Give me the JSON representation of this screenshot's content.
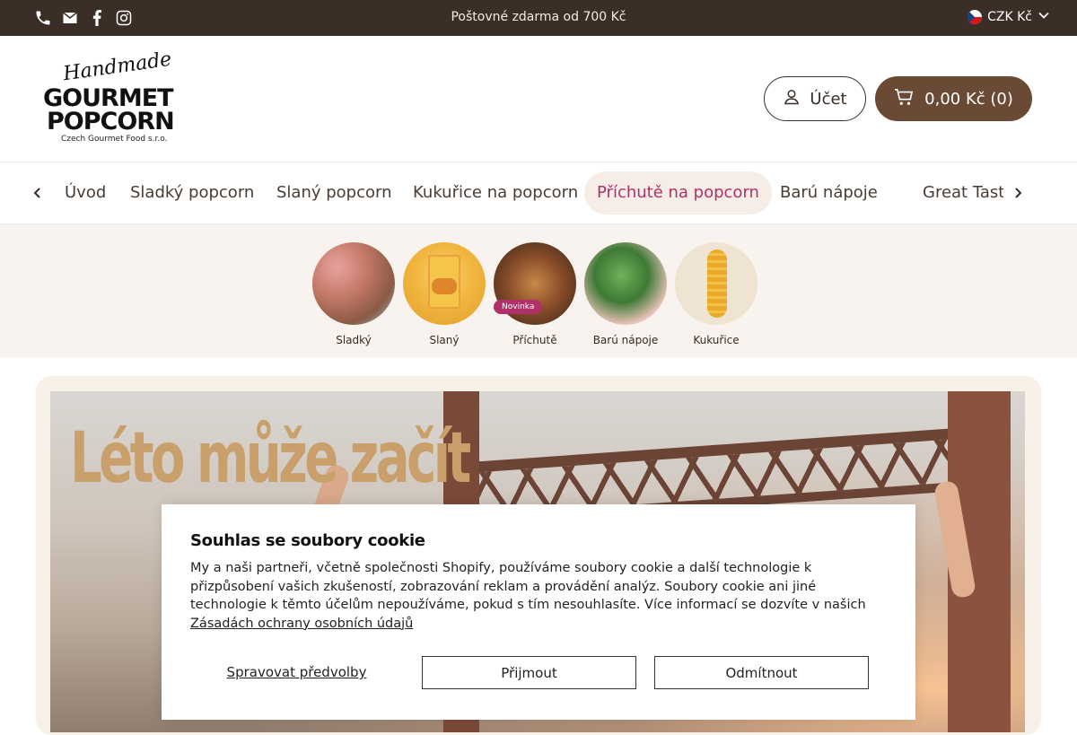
{
  "topbar": {
    "announcement": "Poštovné zdarma od 700 Kč",
    "currency": "CZK Kč",
    "social_icons": [
      "phone-icon",
      "mail-icon",
      "facebook-icon",
      "instagram-icon"
    ]
  },
  "header": {
    "logo": {
      "script": "Handmade",
      "line1": "GOURMET",
      "line2": "POPCORN",
      "sub": "Czech Gourmet Food s.r.o."
    },
    "account_label": "Účet",
    "cart_label": "0,00 Kč (0)"
  },
  "nav": {
    "items": [
      {
        "label": "Úvod",
        "active": false
      },
      {
        "label": "Sladký popcorn",
        "active": false
      },
      {
        "label": "Slaný popcorn",
        "active": false
      },
      {
        "label": "Kukuřice na popcorn",
        "active": false
      },
      {
        "label": "Příchutě na popcorn",
        "active": true
      },
      {
        "label": "Barú nápoje",
        "active": false
      },
      {
        "label": "Great Taste",
        "active": false
      }
    ]
  },
  "categories": [
    {
      "label": "Sladký"
    },
    {
      "label": "Slaný"
    },
    {
      "label": "Příchutě",
      "badge": "Novinka"
    },
    {
      "label": "Barú nápoje"
    },
    {
      "label": "Kukuřice"
    }
  ],
  "hero": {
    "headline": "Léto může začít"
  },
  "cookie": {
    "title": "Souhlas se soubory cookie",
    "body": "My a naši partneři, včetně společnosti Shopify, používáme soubory cookie a další technologie k přizpůsobení vašich zkušeností, zobrazování reklam a provádění analýz. Soubory cookie ani jiné technologie k těmto účelům nepoužíváme, pokud s tím nesouhlasíte. Více informací se dozvíte v našich",
    "privacy_link": "Zásadách ochrany osobních údajů",
    "manage_label": "Spravovat předvolby",
    "accept_label": "Přijmout",
    "decline_label": "Odmítnout"
  },
  "colors": {
    "topbar": "#3b2e26",
    "cart_button": "#6b4a35",
    "active_nav_text": "#b0306a",
    "active_nav_bg": "#f6eee6",
    "badge": "#b0306a",
    "category_band": "#f8f3ee"
  }
}
